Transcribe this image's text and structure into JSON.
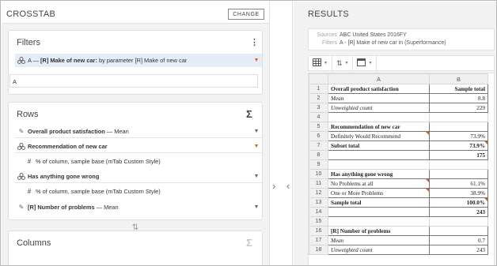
{
  "left": {
    "title": "CROSSTAB",
    "change_label": "CHANGE",
    "filters": {
      "title": "Filters",
      "item": {
        "prefix": "A — ",
        "bold": "[R] Make of new car:",
        "rest": " by parameter [R] Make of new car"
      },
      "input_value": "A"
    },
    "rows": {
      "title": "Rows",
      "items": [
        {
          "bold": "Overall product satisfaction",
          "rest": " — Mean"
        },
        {
          "bold": "Recommendation of new car",
          "rest": ""
        },
        {
          "bold": "",
          "rest": "% of column, sample base (mTab Custom Style)"
        },
        {
          "bold": "Has anything gone wrong",
          "rest": ""
        },
        {
          "bold": "",
          "rest": "% of column, sample base (mTab Custom Style)"
        },
        {
          "bold": "[R] Number of problems",
          "rest": " — Mean"
        }
      ]
    },
    "columns": {
      "title": "Columns"
    },
    "sigma": "Σ"
  },
  "right": {
    "title": "RESULTS",
    "sources_label": "Sources",
    "sources_value": "ABC United States 2016FY",
    "filters_label": "Filters",
    "filters_value": "A - [R] Make of new car in (Superformance)",
    "col_headers": [
      "A",
      "B"
    ],
    "rows": [
      {
        "n": "1",
        "a": "Overall product satisfaction",
        "b": "Sample total",
        "style": "b",
        "bstyle": "b"
      },
      {
        "n": "2",
        "a": "Mean",
        "b": "8.8",
        "style": "i"
      },
      {
        "n": "3",
        "a": "Unweighted count",
        "b": "229",
        "style": "i"
      },
      {
        "n": "4",
        "a": "",
        "b": "",
        "style": "empty"
      },
      {
        "n": "5",
        "a": "Recommendation of new car",
        "b": "",
        "style": "b"
      },
      {
        "n": "6",
        "a": "Definitely Would Recommend",
        "b": "73.9%",
        "style": ""
      },
      {
        "n": "7",
        "a": "Subset total",
        "b": "73.9%",
        "style": "b",
        "bstyle": "b"
      },
      {
        "n": "8",
        "a": "",
        "b": "175",
        "style": "b",
        "bstyle": "b"
      },
      {
        "n": "9",
        "a": "",
        "b": "",
        "style": "empty"
      },
      {
        "n": "10",
        "a": "Has anything gone wrong",
        "b": "",
        "style": "b"
      },
      {
        "n": "11",
        "a": "No Problems at all",
        "b": "61.1%",
        "style": ""
      },
      {
        "n": "12",
        "a": "One or More Problems",
        "b": "38.9%",
        "style": ""
      },
      {
        "n": "13",
        "a": "Sample total",
        "b": "100.0%",
        "style": "b",
        "bstyle": "b"
      },
      {
        "n": "14",
        "a": "",
        "b": "243",
        "style": "b",
        "bstyle": "b"
      },
      {
        "n": "15",
        "a": "",
        "b": "",
        "style": "empty"
      },
      {
        "n": "16",
        "a": "[R] Number of problems",
        "b": "",
        "style": "b"
      },
      {
        "n": "17",
        "a": "Mean",
        "b": "0.7",
        "style": "i"
      },
      {
        "n": "18",
        "a": "Unweighted count",
        "b": "243",
        "style": "i"
      }
    ]
  },
  "colors": {
    "accent_orange": "#e45b1a",
    "selection": "#e5eef8"
  }
}
